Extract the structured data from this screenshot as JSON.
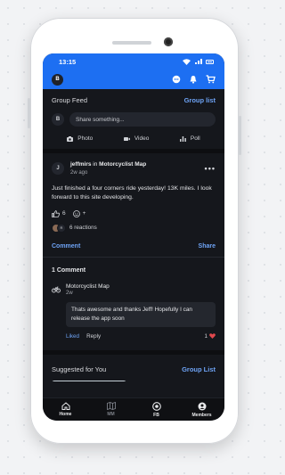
{
  "status_bar": {
    "time": "13:15"
  },
  "app_bar": {
    "avatar_letter": "B",
    "icons": [
      "chat-icon",
      "bell-icon",
      "cart-icon"
    ],
    "accent_color": "#1d6ff2"
  },
  "group_feed": {
    "title": "Group Feed",
    "link": "Group list",
    "avatar_letter": "B",
    "share_placeholder": "Share something...",
    "media": [
      {
        "icon": "camera-icon",
        "label": "Photo"
      },
      {
        "icon": "video-icon",
        "label": "Video"
      },
      {
        "icon": "poll-icon",
        "label": "Poll"
      }
    ]
  },
  "post": {
    "avatar_letter": "J",
    "author": "jeffmirs",
    "in_word": "in",
    "group": "Motorcyclist Map",
    "time": "2w ago",
    "body": "Just finished a four corners ride yesterday!  13K miles. I look forward to this site developing.",
    "like_count": "6",
    "react_add": "+",
    "reactions_text": "6 reactions",
    "reaction_avatar_letter": "R",
    "comment_label": "Comment",
    "share_label": "Share"
  },
  "comments": {
    "title": "1 Comment",
    "items": [
      {
        "author": "Motorcyclist Map",
        "time": "2w",
        "text": "Thats awesome and thanks Jeff! Hopefully I can release the app soon",
        "liked_label": "Liked",
        "reply_label": "Reply",
        "like_count": "1"
      }
    ]
  },
  "suggested": {
    "title": "Suggested for You",
    "link": "Group List"
  },
  "bottom_nav": [
    {
      "icon": "home-icon",
      "label": "Home",
      "active": true
    },
    {
      "icon": "map-icon",
      "label": "MM",
      "active": false
    },
    {
      "icon": "target-icon",
      "label": "FB",
      "active": true
    },
    {
      "icon": "members-icon",
      "label": "Members",
      "active": true
    }
  ]
}
